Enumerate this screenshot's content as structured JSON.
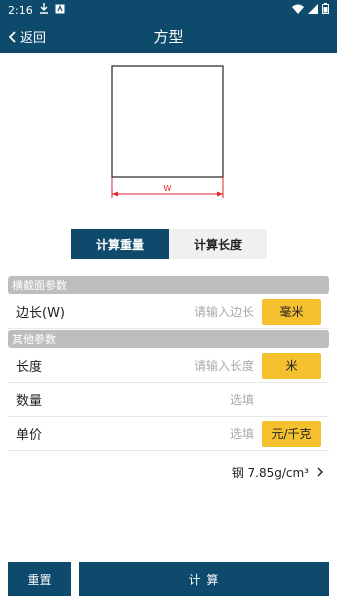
{
  "status_bar": {
    "time": "2:16",
    "notif1": "download-icon",
    "notif2": "app-notification-icon"
  },
  "app_bar": {
    "back_label": "返回",
    "title": "方型"
  },
  "drawing": {
    "dimension_label": "W"
  },
  "tabs": {
    "weight": "计算重量",
    "length": "计算长度"
  },
  "sections": {
    "cross_section": "横截面参数",
    "other": "其他参数"
  },
  "fields": {
    "side": {
      "label": "边长(W)",
      "placeholder": "请输入边长",
      "unit": "毫米"
    },
    "length": {
      "label": "长度",
      "placeholder": "请输入长度",
      "unit": "米"
    },
    "quantity": {
      "label": "数量",
      "placeholder": "选填"
    },
    "price": {
      "label": "单价",
      "placeholder": "选填",
      "unit": "元/千克"
    }
  },
  "material": {
    "text": "钢  7.85g/cm³"
  },
  "bottom": {
    "reset": "重置",
    "calc": "计  算"
  },
  "colors": {
    "primary": "#0d4a6b",
    "accent": "#f5c02e",
    "dimension": "#e0262b"
  }
}
